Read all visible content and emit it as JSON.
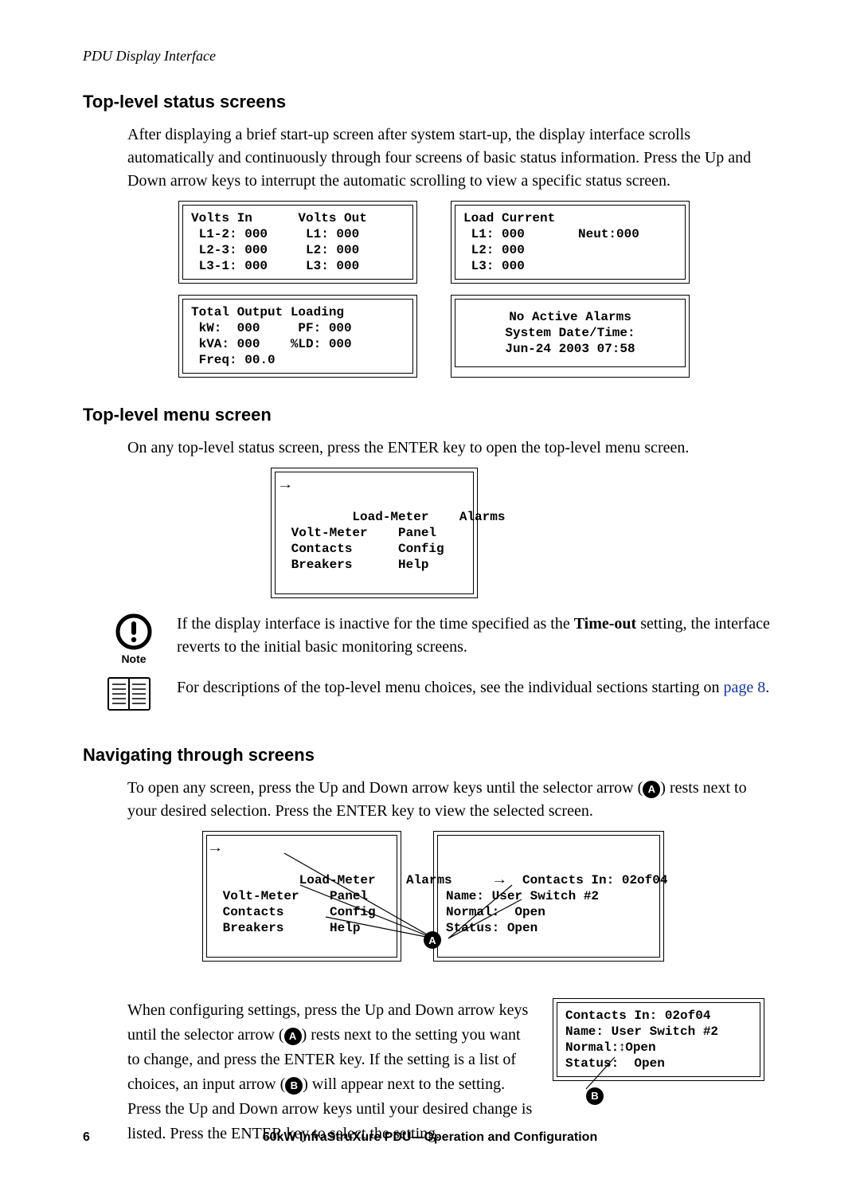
{
  "running_head": "PDU Display Interface",
  "sec1": {
    "title": "Top-level status screens",
    "para": "After displaying a brief start-up screen after system start-up, the display interface scrolls automatically and continuously through four screens of basic status information. Press the Up and Down arrow keys to interrupt the automatic scrolling to view a specific status screen.",
    "screen1": "Volts In      Volts Out\n L1-2: 000     L1: 000\n L2-3: 000     L2: 000\n L3-1: 000     L3: 000",
    "screen2": "Load Current\n L1: 000       Neut:000\n L2: 000\n L3: 000",
    "screen3": "Total Output Loading\n kW:  000     PF: 000\n kVA: 000    %LD: 000\n Freq: 00.0",
    "screen4": "No Active Alarms\nSystem Date/Time:\nJun-24 2003 07:58"
  },
  "sec2": {
    "title": "Top-level menu screen",
    "para_a": "On any top-level status screen, press the ",
    "para_b": " key to open the top-level menu screen.",
    "enter": "ENTER",
    "menu": " Load-Meter    Alarms\n Volt-Meter    Panel\n Contacts      Config\n Breakers      Help",
    "note_label": "Note",
    "note_text_a": "If the display interface is inactive for the time specified as the ",
    "note_bold": "Time-out",
    "note_text_b": " setting, the interface reverts to the initial basic monitoring screens.",
    "ref_a": "For descriptions of the top-level menu choices, see the individual sections starting on ",
    "ref_link": "page 8",
    "ref_b": "."
  },
  "sec3": {
    "title": "Navigating through screens",
    "para1_a": "To open any screen, press the Up and Down arrow keys until the selector arrow (",
    "para1_b": ") rests next to your desired selection. Press the ",
    "para1_c": " key to view the selected screen.",
    "badge_a": "A",
    "badge_b": "B",
    "nav_menu": " Load-Meter    Alarms\n Volt-Meter    Panel\n Contacts      Config\n Breakers      Help",
    "nav_screen": "Contacts In: 02of04\nName: User Switch #2\nNormal:  Open\nStatus: Open",
    "para2_a": "When configuring settings, press the Up and Down arrow keys until the selector arrow (",
    "para2_b": ") rests next to the setting you want to change, and press the ",
    "para2_c": " key. If the setting is a list of choices, an input arrow (",
    "para2_d": ") will appear next to the setting. Press the Up and Down arrow keys until your desired change is listed. Press the ",
    "para2_e": " key to select the setting.",
    "side_screen_l1": "Contacts In: 02of04",
    "side_screen_l2": "Name: User Switch #2",
    "side_screen_l3a": "Normal:",
    "side_screen_l3b": "Open",
    "side_screen_l4": "Status:  Open"
  },
  "footer": {
    "page": "6",
    "title": "60kW InfraStruXure PDU—Operation and Configuration"
  }
}
